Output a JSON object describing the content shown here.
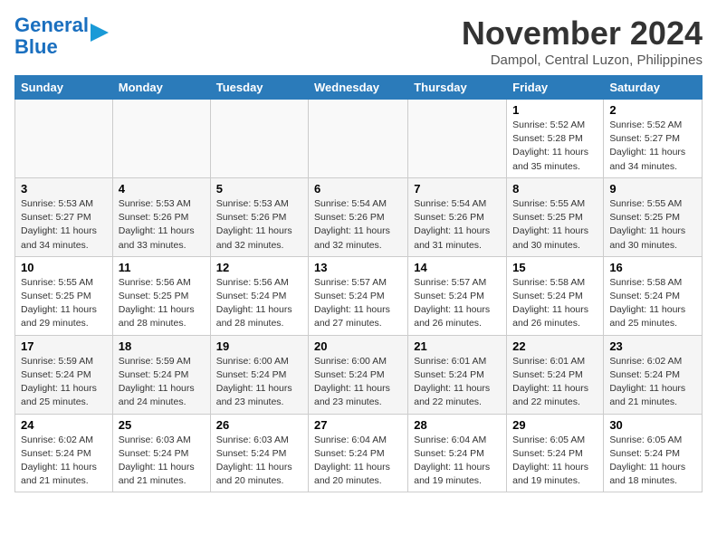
{
  "header": {
    "logo_line1": "General",
    "logo_line2": "Blue",
    "month_title": "November 2024",
    "location": "Dampol, Central Luzon, Philippines"
  },
  "days_of_week": [
    "Sunday",
    "Monday",
    "Tuesday",
    "Wednesday",
    "Thursday",
    "Friday",
    "Saturday"
  ],
  "weeks": [
    [
      {
        "day": "",
        "info": ""
      },
      {
        "day": "",
        "info": ""
      },
      {
        "day": "",
        "info": ""
      },
      {
        "day": "",
        "info": ""
      },
      {
        "day": "",
        "info": ""
      },
      {
        "day": "1",
        "info": "Sunrise: 5:52 AM\nSunset: 5:28 PM\nDaylight: 11 hours\nand 35 minutes."
      },
      {
        "day": "2",
        "info": "Sunrise: 5:52 AM\nSunset: 5:27 PM\nDaylight: 11 hours\nand 34 minutes."
      }
    ],
    [
      {
        "day": "3",
        "info": "Sunrise: 5:53 AM\nSunset: 5:27 PM\nDaylight: 11 hours\nand 34 minutes."
      },
      {
        "day": "4",
        "info": "Sunrise: 5:53 AM\nSunset: 5:26 PM\nDaylight: 11 hours\nand 33 minutes."
      },
      {
        "day": "5",
        "info": "Sunrise: 5:53 AM\nSunset: 5:26 PM\nDaylight: 11 hours\nand 32 minutes."
      },
      {
        "day": "6",
        "info": "Sunrise: 5:54 AM\nSunset: 5:26 PM\nDaylight: 11 hours\nand 32 minutes."
      },
      {
        "day": "7",
        "info": "Sunrise: 5:54 AM\nSunset: 5:26 PM\nDaylight: 11 hours\nand 31 minutes."
      },
      {
        "day": "8",
        "info": "Sunrise: 5:55 AM\nSunset: 5:25 PM\nDaylight: 11 hours\nand 30 minutes."
      },
      {
        "day": "9",
        "info": "Sunrise: 5:55 AM\nSunset: 5:25 PM\nDaylight: 11 hours\nand 30 minutes."
      }
    ],
    [
      {
        "day": "10",
        "info": "Sunrise: 5:55 AM\nSunset: 5:25 PM\nDaylight: 11 hours\nand 29 minutes."
      },
      {
        "day": "11",
        "info": "Sunrise: 5:56 AM\nSunset: 5:25 PM\nDaylight: 11 hours\nand 28 minutes."
      },
      {
        "day": "12",
        "info": "Sunrise: 5:56 AM\nSunset: 5:24 PM\nDaylight: 11 hours\nand 28 minutes."
      },
      {
        "day": "13",
        "info": "Sunrise: 5:57 AM\nSunset: 5:24 PM\nDaylight: 11 hours\nand 27 minutes."
      },
      {
        "day": "14",
        "info": "Sunrise: 5:57 AM\nSunset: 5:24 PM\nDaylight: 11 hours\nand 26 minutes."
      },
      {
        "day": "15",
        "info": "Sunrise: 5:58 AM\nSunset: 5:24 PM\nDaylight: 11 hours\nand 26 minutes."
      },
      {
        "day": "16",
        "info": "Sunrise: 5:58 AM\nSunset: 5:24 PM\nDaylight: 11 hours\nand 25 minutes."
      }
    ],
    [
      {
        "day": "17",
        "info": "Sunrise: 5:59 AM\nSunset: 5:24 PM\nDaylight: 11 hours\nand 25 minutes."
      },
      {
        "day": "18",
        "info": "Sunrise: 5:59 AM\nSunset: 5:24 PM\nDaylight: 11 hours\nand 24 minutes."
      },
      {
        "day": "19",
        "info": "Sunrise: 6:00 AM\nSunset: 5:24 PM\nDaylight: 11 hours\nand 23 minutes."
      },
      {
        "day": "20",
        "info": "Sunrise: 6:00 AM\nSunset: 5:24 PM\nDaylight: 11 hours\nand 23 minutes."
      },
      {
        "day": "21",
        "info": "Sunrise: 6:01 AM\nSunset: 5:24 PM\nDaylight: 11 hours\nand 22 minutes."
      },
      {
        "day": "22",
        "info": "Sunrise: 6:01 AM\nSunset: 5:24 PM\nDaylight: 11 hours\nand 22 minutes."
      },
      {
        "day": "23",
        "info": "Sunrise: 6:02 AM\nSunset: 5:24 PM\nDaylight: 11 hours\nand 21 minutes."
      }
    ],
    [
      {
        "day": "24",
        "info": "Sunrise: 6:02 AM\nSunset: 5:24 PM\nDaylight: 11 hours\nand 21 minutes."
      },
      {
        "day": "25",
        "info": "Sunrise: 6:03 AM\nSunset: 5:24 PM\nDaylight: 11 hours\nand 21 minutes."
      },
      {
        "day": "26",
        "info": "Sunrise: 6:03 AM\nSunset: 5:24 PM\nDaylight: 11 hours\nand 20 minutes."
      },
      {
        "day": "27",
        "info": "Sunrise: 6:04 AM\nSunset: 5:24 PM\nDaylight: 11 hours\nand 20 minutes."
      },
      {
        "day": "28",
        "info": "Sunrise: 6:04 AM\nSunset: 5:24 PM\nDaylight: 11 hours\nand 19 minutes."
      },
      {
        "day": "29",
        "info": "Sunrise: 6:05 AM\nSunset: 5:24 PM\nDaylight: 11 hours\nand 19 minutes."
      },
      {
        "day": "30",
        "info": "Sunrise: 6:05 AM\nSunset: 5:24 PM\nDaylight: 11 hours\nand 18 minutes."
      }
    ]
  ]
}
